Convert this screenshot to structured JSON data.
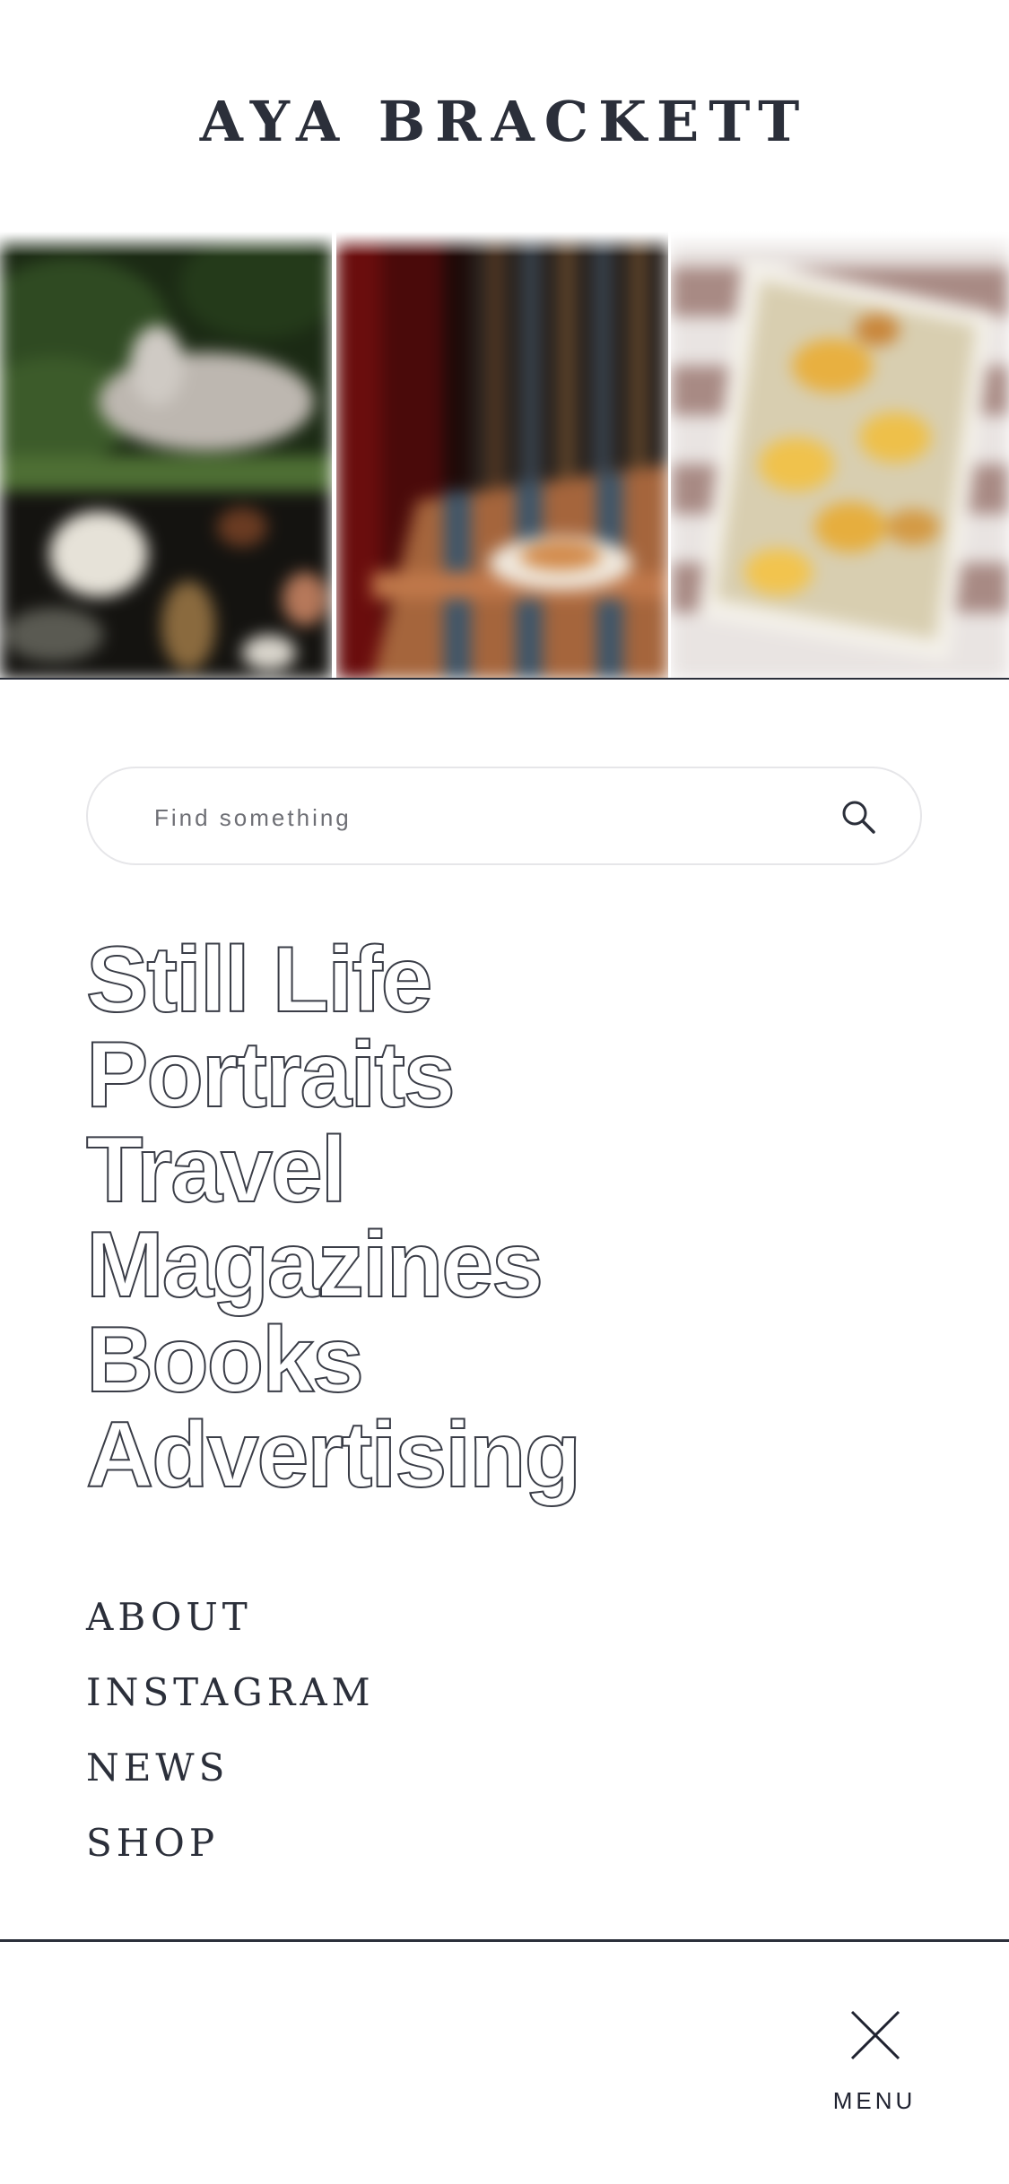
{
  "site": {
    "title": "AYA BRACKETT"
  },
  "hero": {
    "images": [
      {
        "name": "still-life-rabbit-image"
      },
      {
        "name": "striped-chair-image"
      },
      {
        "name": "pastry-tray-image"
      }
    ]
  },
  "search": {
    "placeholder": "Find something",
    "value": "",
    "icon": "search-icon"
  },
  "categories": [
    {
      "label": "Still Life"
    },
    {
      "label": "Portraits"
    },
    {
      "label": "Travel"
    },
    {
      "label": "Magazines"
    },
    {
      "label": "Books"
    },
    {
      "label": "Advertising"
    }
  ],
  "links": [
    {
      "label": "ABOUT"
    },
    {
      "label": "INSTAGRAM"
    },
    {
      "label": "NEWS"
    },
    {
      "label": "SHOP"
    }
  ],
  "footer": {
    "menu_label": "MENU",
    "icon": "close-icon"
  },
  "colors": {
    "text": "#2b2f3a",
    "background": "#ffffff",
    "search_border": "#e6e6e9"
  }
}
